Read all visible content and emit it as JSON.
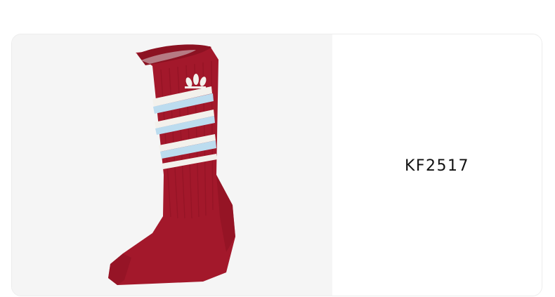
{
  "product": {
    "sku": "KF2517",
    "image_subject": "sock",
    "colors": {
      "sock_red": "#a3182b",
      "sock_dark": "#8c1222",
      "stripe_blue": "#bcdcef",
      "stripe_white": "#f3f1ec",
      "panel_bg": "#f5f5f5"
    }
  }
}
